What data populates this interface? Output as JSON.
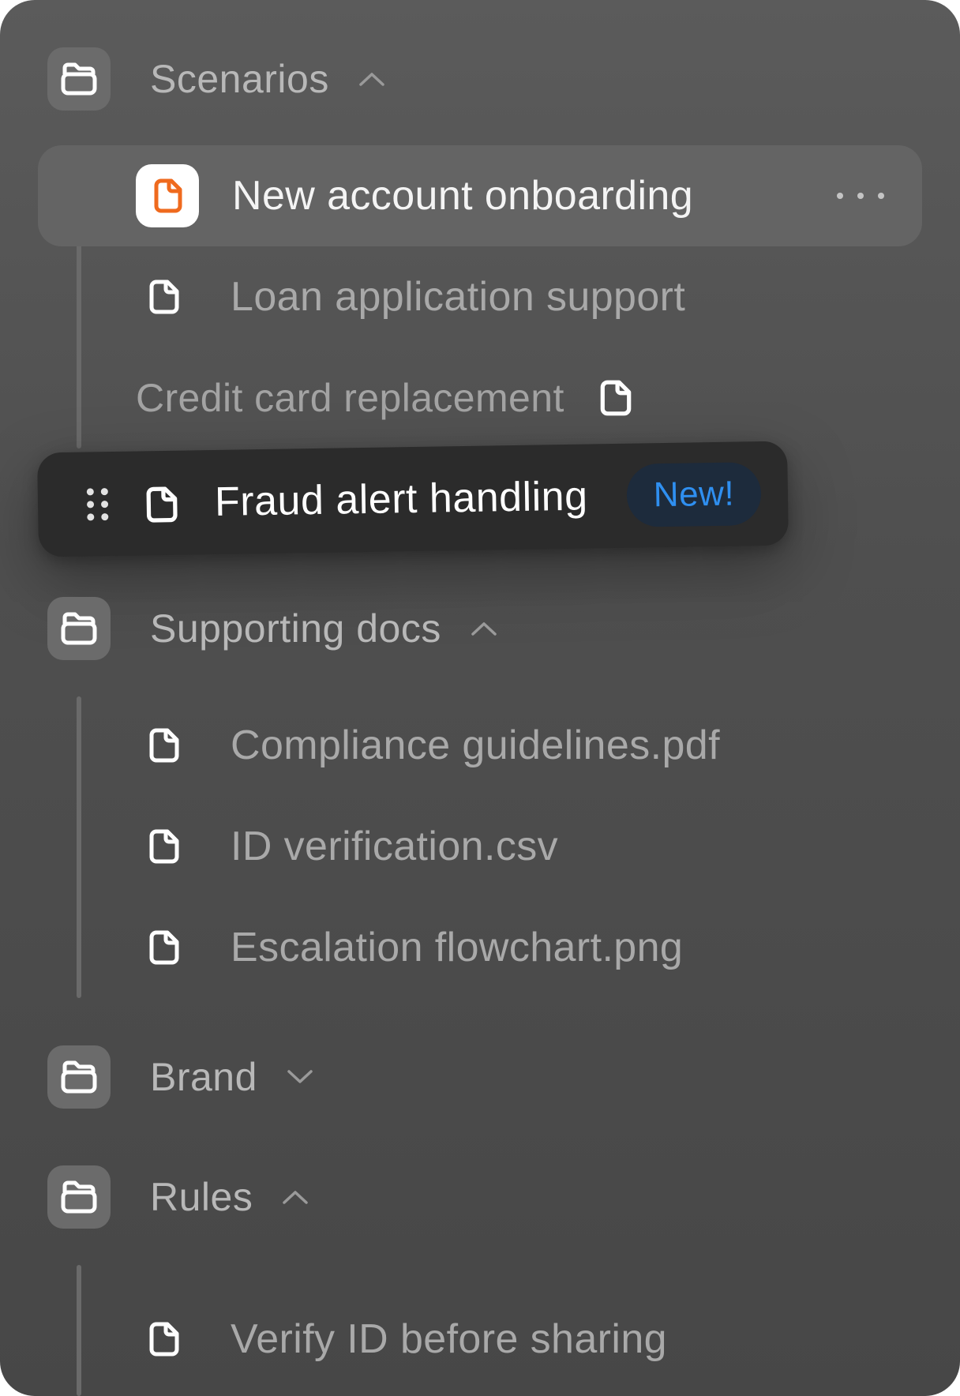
{
  "groups": {
    "scenarios": {
      "label": "Scenarios",
      "expanded": true,
      "items": [
        {
          "label": "New account onboarding",
          "selected": true
        },
        {
          "label": "Loan application support"
        },
        {
          "label": "Credit card replacement"
        }
      ]
    },
    "dragging": {
      "label": "Fraud alert handling",
      "badge": "New!"
    },
    "supporting": {
      "label": "Supporting docs",
      "expanded": true,
      "items": [
        {
          "label": "Compliance guidelines.pdf"
        },
        {
          "label": "ID verification.csv"
        },
        {
          "label": "Escalation flowchart.png"
        }
      ]
    },
    "brand": {
      "label": "Brand",
      "expanded": false
    },
    "rules": {
      "label": "Rules",
      "expanded": true,
      "items": [
        {
          "label": "Verify ID before sharing"
        }
      ]
    }
  },
  "colors": {
    "accent_orange": "#ef6a1e",
    "badge_blue": "#2f8ff0"
  },
  "icons": {
    "folder": "folder-icon",
    "file": "file-icon",
    "chevron_up": "chevron-up-icon",
    "chevron_down": "chevron-down-icon",
    "more": "more-horizontal-icon",
    "drag": "drag-handle-icon"
  }
}
